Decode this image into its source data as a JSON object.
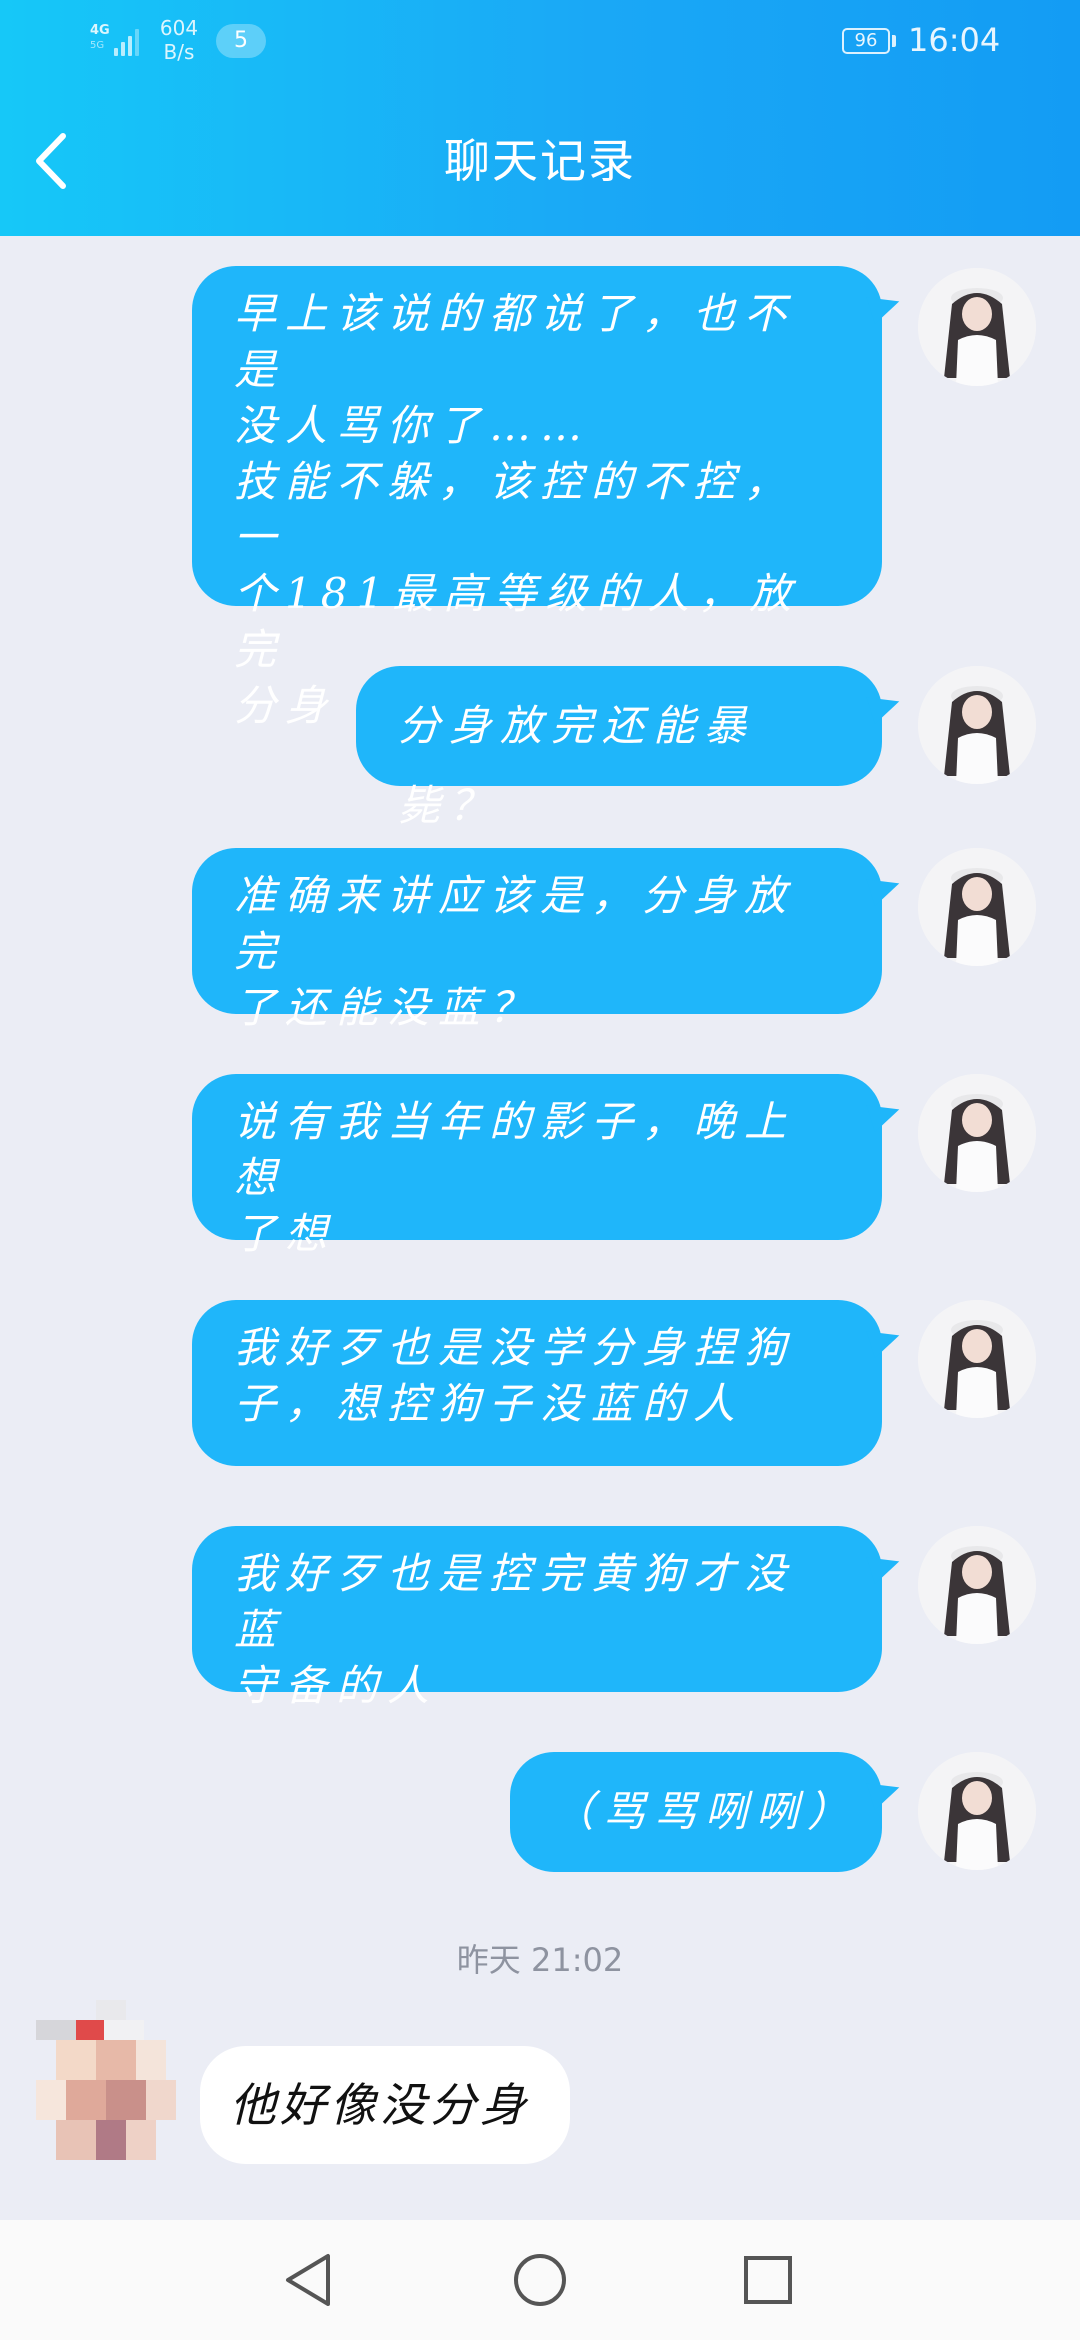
{
  "status_bar": {
    "network": "4G",
    "network_sub": "5G",
    "speed_value": "604",
    "speed_unit": "B/s",
    "notification_count": "5",
    "battery": "96",
    "time": "16:04"
  },
  "header": {
    "title": "聊天记录"
  },
  "messages": [
    {
      "side": "right",
      "lines": [
        "早上该说的都说了，也不是",
        "没人骂你了……",
        "技能不躲，该控的不控，一",
        "个181最高等级的人，放完",
        "分身"
      ]
    },
    {
      "side": "right",
      "lines": [
        "分身放完还能暴毙？"
      ]
    },
    {
      "side": "right",
      "lines": [
        "准确来讲应该是，分身放完",
        "了还能没蓝？"
      ]
    },
    {
      "side": "right",
      "lines": [
        "说有我当年的影子，晚上想",
        "了想"
      ]
    },
    {
      "side": "right",
      "lines": [
        "我好歹也是没学分身捏狗",
        "子，想控狗子没蓝的人"
      ]
    },
    {
      "side": "right",
      "lines": [
        "我好歹也是控完黄狗才没蓝",
        "守备的人"
      ]
    },
    {
      "side": "right",
      "lines": [
        "（骂骂咧咧）"
      ]
    }
  ],
  "timestamp": "昨天 21:02",
  "left_message": "他好像没分身",
  "colors": {
    "header_start": "#16c8f8",
    "header_end": "#139cf4",
    "bubble": "#1fb6fa",
    "background": "#ebedf5"
  }
}
